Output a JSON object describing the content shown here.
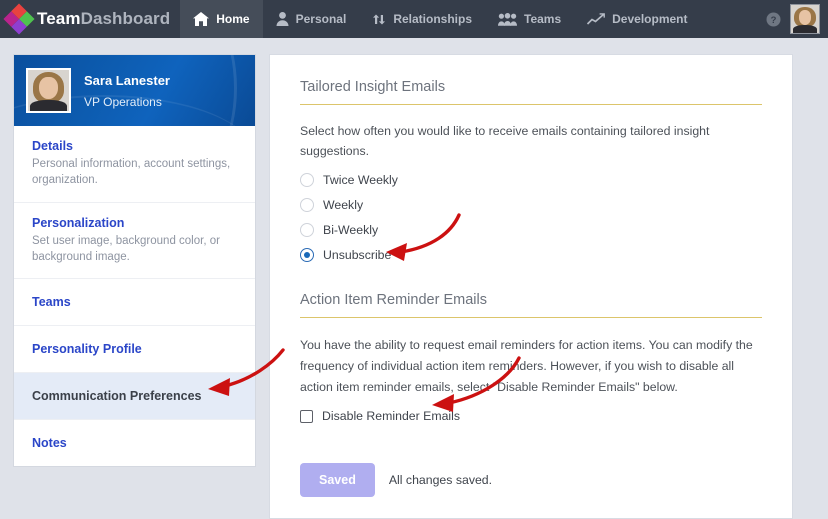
{
  "topnav": {
    "brand_bold": "Team",
    "brand_light": "Dashboard",
    "items": [
      {
        "label": "Home",
        "icon": "home-icon",
        "active": true
      },
      {
        "label": "Personal",
        "icon": "person-icon",
        "active": false
      },
      {
        "label": "Relationships",
        "icon": "exchange-arrows-icon",
        "active": false
      },
      {
        "label": "Teams",
        "icon": "group-icon",
        "active": false
      },
      {
        "label": "Development",
        "icon": "line-chart-icon",
        "active": false
      }
    ],
    "help_icon": "help-circle-icon",
    "avatar": "user-avatar"
  },
  "sidebar": {
    "profile": {
      "name": "Sara Lanester",
      "role": "VP Operations"
    },
    "items": [
      {
        "title": "Details",
        "desc": "Personal information, account settings, organization.",
        "active": false
      },
      {
        "title": "Personalization",
        "desc": "Set user image, background color, or background image.",
        "active": false
      },
      {
        "title": "Teams",
        "desc": "",
        "active": false
      },
      {
        "title": "Personality Profile",
        "desc": "",
        "active": false
      },
      {
        "title": "Communication Preferences",
        "desc": "",
        "active": true
      },
      {
        "title": "Notes",
        "desc": "",
        "active": false
      }
    ]
  },
  "main": {
    "section1": {
      "title": "Tailored Insight Emails",
      "description": "Select how often you would like to receive emails containing tailored insight suggestions.",
      "options": [
        {
          "label": "Twice Weekly",
          "selected": false
        },
        {
          "label": "Weekly",
          "selected": false
        },
        {
          "label": "Bi-Weekly",
          "selected": false
        },
        {
          "label": "Unsubscribe",
          "selected": true
        }
      ]
    },
    "section2": {
      "title": "Action Item Reminder Emails",
      "paragraph": "You have the ability to request email reminders for action items. You can modify the frequency of individual action item reminders. However, if you wish to disable all action item reminder emails, select \"Disable Reminder Emails\" below.",
      "checkbox_label": "Disable Reminder Emails",
      "checkbox_checked": false
    },
    "footer": {
      "save_label": "Saved",
      "save_note": "All changes saved."
    }
  },
  "annotations": {
    "arrow_color": "#cc1111",
    "arrows": [
      {
        "name": "arrow-to-unsubscribe-radio"
      },
      {
        "name": "arrow-to-communication-preferences"
      },
      {
        "name": "arrow-to-disable-reminder-checkbox"
      }
    ]
  },
  "colors": {
    "header_bg": "#353d4a",
    "page_bg": "#dfe2e9",
    "accent_rule": "#dcc56b",
    "link_blue": "#2b46c8",
    "saved_button": "#b0aef0",
    "radio_selected": "#1a69b8"
  }
}
